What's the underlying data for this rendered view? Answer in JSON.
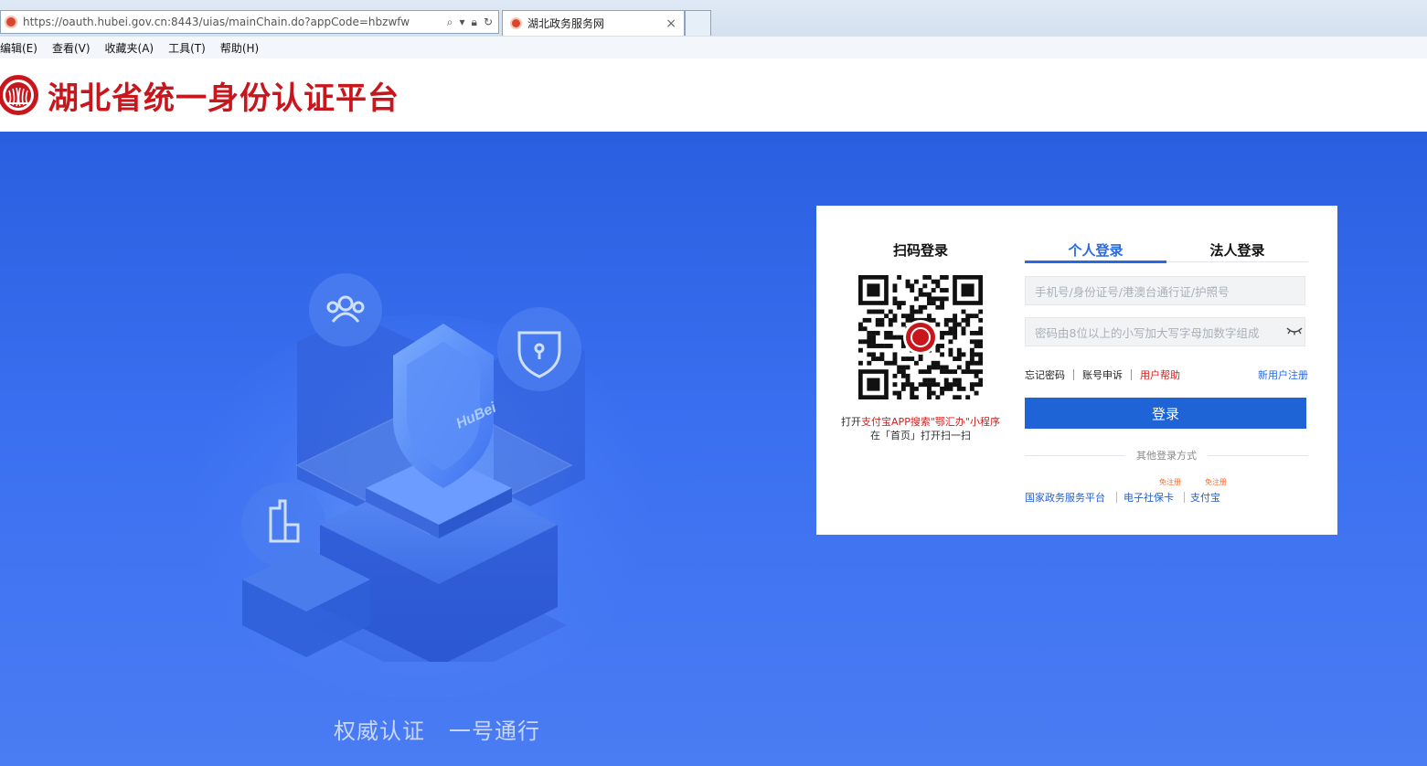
{
  "browser": {
    "url": "https://oauth.hubei.gov.cn:8443/uias/mainChain.do?appCode=hbzwfw",
    "tab_title": "湖北政务服务网",
    "tab_close": "×",
    "menu": [
      "编辑(E)",
      "查看(V)",
      "收藏夹(A)",
      "工具(T)",
      "帮助(H)"
    ]
  },
  "header": {
    "site_title": "湖北省统一身份认证平台"
  },
  "hero": {
    "illustration_text": "HuBei",
    "slogan": [
      "权威认证",
      "一号通行"
    ]
  },
  "login": {
    "qr_title": "扫码登录",
    "qr_tip_prefix": "打开",
    "qr_tip_highlight": "支付宝APP搜索\"鄂汇办\"小程序",
    "qr_tip_line2": "在「首页」打开扫一扫",
    "tabs": [
      "个人登录",
      "法人登录"
    ],
    "active_tab": "个人登录",
    "account_placeholder": "手机号/身份证号/港澳台通行证/护照号",
    "password_placeholder": "密码由8位以上的小写加大写字母加数字组成",
    "forgot_password": "忘记密码",
    "account_appeal": "账号申诉",
    "user_help": "用户帮助",
    "register": "新用户注册",
    "login_button": "登录",
    "other_methods": "其他登录方式",
    "alt_methods": [
      {
        "label": "国家政务服务平台",
        "tag": ""
      },
      {
        "label": "电子社保卡",
        "tag": "免注册"
      },
      {
        "label": "支付宝",
        "tag": "免注册"
      }
    ]
  },
  "colors": {
    "brand_red": "#c8161d",
    "primary_blue": "#1f64d6",
    "hero_blue": "#3a6ff0"
  }
}
